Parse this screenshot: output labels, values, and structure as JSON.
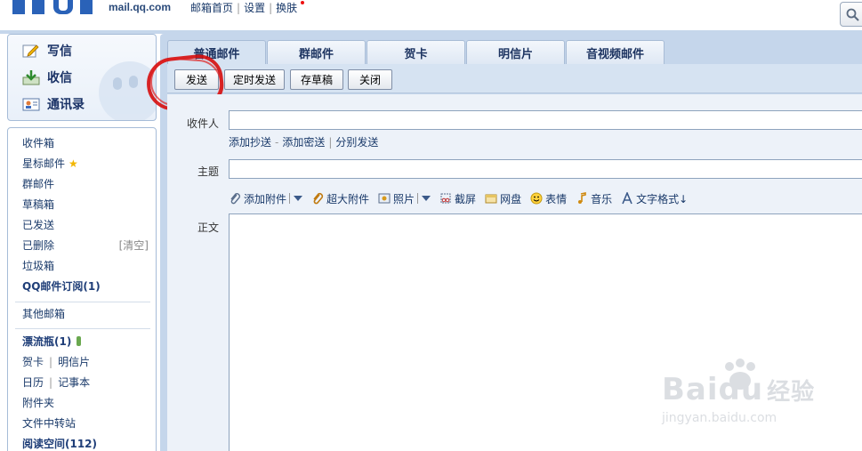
{
  "header": {
    "logo_domain": "mail.qq.com",
    "nav": [
      "邮箱首页",
      "设置",
      "换肤"
    ]
  },
  "quick_actions": [
    {
      "label": "写信",
      "icon": "pencil-icon"
    },
    {
      "label": "收信",
      "icon": "inbox-download-icon"
    },
    {
      "label": "通讯录",
      "icon": "contacts-card-icon"
    }
  ],
  "folders": {
    "inbox": "收件箱",
    "starred": "星标邮件",
    "group": "群邮件",
    "drafts": "草稿箱",
    "sent": "已发送",
    "deleted": "已删除",
    "clear": "[清空]",
    "spam": "垃圾箱",
    "subscription": "QQ邮件订阅(1)",
    "other": "其他邮箱",
    "bottle": "漂流瓶(1)",
    "greeting_card": "贺卡",
    "postcard": "明信片",
    "calendar": "日历",
    "notebook": "记事本",
    "attachments": "附件夹",
    "file_transfer": "文件中转站",
    "reading_space": "阅读空间(112)"
  },
  "tabs": [
    "普通邮件",
    "群邮件",
    "贺卡",
    "明信片",
    "音视频邮件"
  ],
  "toolbar": {
    "send": "发送",
    "scheduled_send": "定时发送",
    "save_draft": "存草稿",
    "close": "关闭"
  },
  "compose": {
    "to_label": "收件人",
    "cc_links": [
      "添加抄送",
      "添加密送",
      "分别发送"
    ],
    "subject_label": "主题",
    "body_label": "正文",
    "attach_tools": [
      "添加附件",
      "超大附件",
      "照片",
      "截屏",
      "网盘",
      "表情",
      "音乐",
      "文字格式↓"
    ]
  },
  "watermark": {
    "brand": "Bai",
    "brand2": "du",
    "cn": "经验",
    "url": "jingyan.baidu.com"
  },
  "colors": {
    "annotation": "#d60d0d",
    "nav_text": "#1a3a6a",
    "panel_bg": "#c5d6eb"
  }
}
